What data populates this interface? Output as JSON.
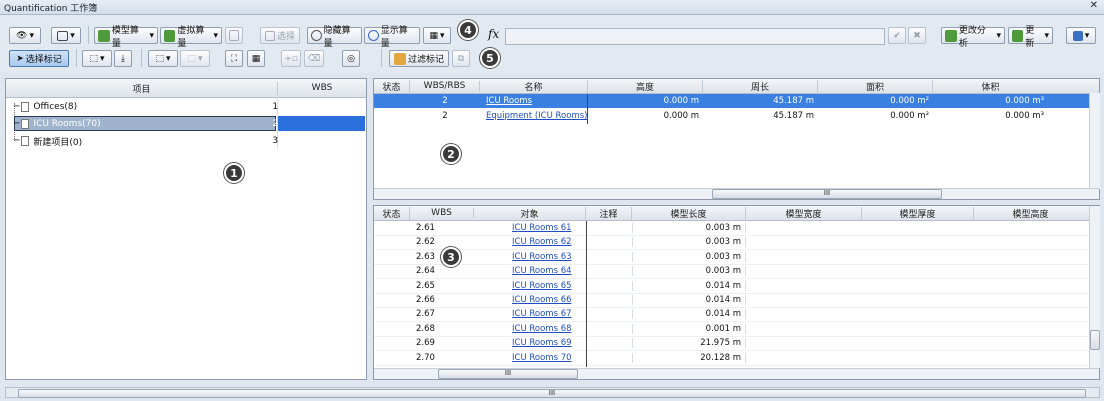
{
  "window": {
    "title": "Quantification 工作簿",
    "close": "✕"
  },
  "toolbar": {
    "model_takeoff": "模型算量",
    "virtual_takeoff": "虚拟算量",
    "select": "选择",
    "hide_takeoff": "隐藏算量",
    "show_takeoff": "显示算量",
    "fx": "fx",
    "change_analysis": "更改分析",
    "update": "更新",
    "select_markup": "选择标记",
    "filter_markup": "过滤标记"
  },
  "callouts": [
    "1",
    "2",
    "3",
    "4",
    "5"
  ],
  "tree": {
    "headers": {
      "item": "项目",
      "wbs": "WBS"
    },
    "rows": [
      {
        "label": "Offices(8)",
        "wbs": "1"
      },
      {
        "label": "ICU Rooms(70)",
        "wbs": "2"
      },
      {
        "label": "新建项目(0)",
        "wbs": "3"
      }
    ]
  },
  "top_grid": {
    "headers": [
      "状态",
      "WBS/RBS",
      "名称",
      "高度",
      "周长",
      "面积",
      "体积"
    ],
    "rows": [
      {
        "wbs": "2",
        "name": "ICU Rooms",
        "height": "0.000 m",
        "perimeter": "45.187 m",
        "area": "0.000 m²",
        "volume": "0.000 m³"
      },
      {
        "wbs": "2",
        "name": "Equipment (ICU Rooms)",
        "height": "0.000 m",
        "perimeter": "45.187 m",
        "area": "0.000 m²",
        "volume": "0.000 m³"
      }
    ],
    "scroll_glyph": "III"
  },
  "bottom_grid": {
    "headers": [
      "状态",
      "WBS",
      "对象",
      "注释",
      "模型长度",
      "模型宽度",
      "模型厚度",
      "模型高度"
    ],
    "rows": [
      {
        "wbs": "2.61",
        "obj": "ICU Rooms 61",
        "len": "0.003 m"
      },
      {
        "wbs": "2.62",
        "obj": "ICU Rooms 62",
        "len": "0.003 m"
      },
      {
        "wbs": "2.63",
        "obj": "ICU Rooms 63",
        "len": "0.003 m"
      },
      {
        "wbs": "2.64",
        "obj": "ICU Rooms 64",
        "len": "0.003 m"
      },
      {
        "wbs": "2.65",
        "obj": "ICU Rooms 65",
        "len": "0.014 m"
      },
      {
        "wbs": "2.66",
        "obj": "ICU Rooms 66",
        "len": "0.014 m"
      },
      {
        "wbs": "2.67",
        "obj": "ICU Rooms 67",
        "len": "0.014 m"
      },
      {
        "wbs": "2.68",
        "obj": "ICU Rooms 68",
        "len": "0.001 m"
      },
      {
        "wbs": "2.69",
        "obj": "ICU Rooms 69",
        "len": "21.975 m"
      },
      {
        "wbs": "2.70",
        "obj": "ICU Rooms 70",
        "len": "20.128 m"
      }
    ],
    "scroll_glyph": "III"
  },
  "bottom_scroll_glyph": "III",
  "colors": {
    "selection": "#3a80e0",
    "tree_selection": "#9fb4cc",
    "link": "#1f4fc2"
  }
}
